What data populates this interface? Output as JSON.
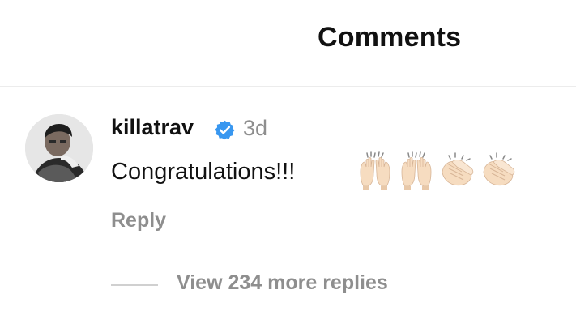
{
  "header": {
    "title": "Comments"
  },
  "comment": {
    "username": "killatrav",
    "verified_icon": "verified-badge-icon",
    "timestamp": "3d",
    "text": "Congratulations!!!",
    "emojis": [
      "raising-hands-icon",
      "raising-hands-icon",
      "clapping-hands-icon",
      "clapping-hands-icon"
    ],
    "reply_label": "Reply",
    "view_replies_label": "View 234 more replies"
  },
  "colors": {
    "verified_blue": "#3897f0",
    "secondary_text": "#8e8e8e",
    "primary_text": "#111111",
    "divider": "#ececec",
    "emoji_skin": "#f6dcc0"
  }
}
